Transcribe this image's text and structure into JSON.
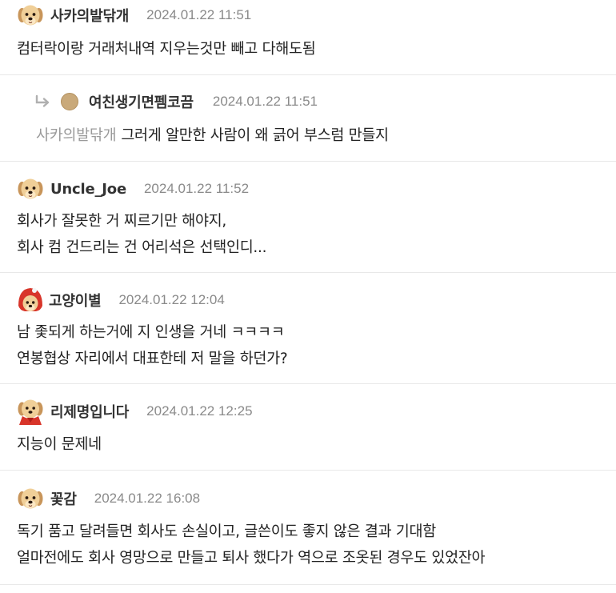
{
  "comments": [
    {
      "nickname": "사카의발닦개",
      "timestamp": "2024.01.22 11:51",
      "lines": [
        "컴터락이랑 거래처내역 지우는것만 빼고 다해도됨"
      ]
    },
    {
      "nickname": "여친생기면펨코끔",
      "timestamp": "2024.01.22 11:51",
      "mention": "사카의발닦개",
      "lines": [
        "그러게 알만한 사람이 왜 긁어 부스럼 만들지"
      ]
    },
    {
      "nickname": "Uncle_Joe",
      "timestamp": "2024.01.22 11:52",
      "lines": [
        "회사가 잘못한 거 찌르기만 해야지,",
        "회사 컴 건드리는 건 어리석은 선택인디..."
      ]
    },
    {
      "nickname": "고양이별",
      "timestamp": "2024.01.22 12:04",
      "lines": [
        "남 좇되게 하는거에 지 인생을 거네 ㅋㅋㅋㅋ",
        "연봉협상 자리에서 대표한테 저 말을 하던가?"
      ]
    },
    {
      "nickname": "리제명입니다",
      "timestamp": "2024.01.22 12:25",
      "lines": [
        "지능이 문제네"
      ]
    },
    {
      "nickname": "꽃감",
      "timestamp": "2024.01.22 16:08",
      "lines": [
        "독기 품고 달려들면 회사도 손실이고, 글쓴이도 좋지 않은 결과 기대함",
        "얼마전에도 회사 영망으로 만들고 퇴사 했다가 역으로 조옷된 경우도 있었잔아"
      ]
    }
  ],
  "icons": {
    "dog_avatar": "puppy-face-icon",
    "reply_arrow": "reply-arrow-icon",
    "hat_avatar": "puppy-red-hood-icon",
    "cape_avatar": "puppy-red-cape-icon",
    "reply_avatar": "brown-circle-avatar"
  },
  "colors": {
    "text": "#222222",
    "nickname": "#333333",
    "timestamp": "#8a8a8a",
    "mention": "#9a9a9a",
    "divider": "#e8e8e8",
    "dog_fur": "#e8c48a"
  }
}
